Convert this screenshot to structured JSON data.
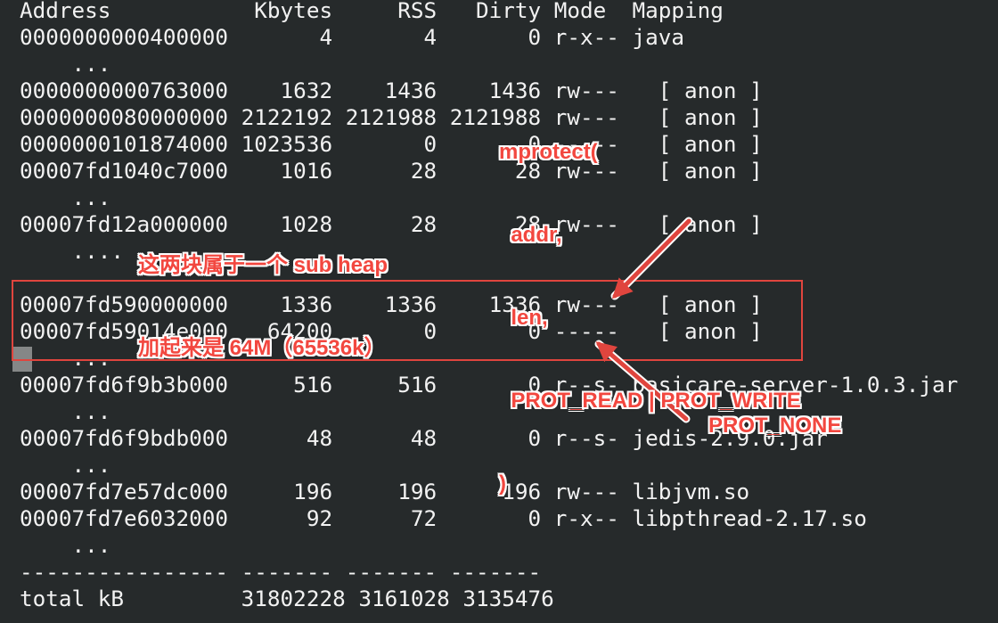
{
  "terminal": {
    "lines": [
      "Address           Kbytes     RSS   Dirty Mode  Mapping",
      "0000000000400000       4       4       0 r-x-- java",
      "    ...",
      "0000000000763000    1632    1436    1436 rw---   [ anon ]",
      "0000000080000000 2122192 2121988 2121988 rw---   [ anon ]",
      "0000000101874000 1023536       0       0 -----   [ anon ]",
      "00007fd1040c7000    1016      28      28 rw---   [ anon ]",
      "    ...",
      "00007fd12a000000    1028      28      28 rw---   [ anon ]",
      "    ....",
      "",
      "00007fd590000000    1336    1336    1336 rw---   [ anon ]",
      "00007fd59014e000   64200       0       0 -----   [ anon ]",
      "    ...",
      "00007fd6f9b3b000     516     516       0 r--s- basicare-server-1.0.3.jar",
      "    ...",
      "00007fd6f9bdb000      48      48       0 r--s- jedis-2.9.0.jar",
      "    ...",
      "00007fd7e57dc000     196     196     196 rw--- libjvm.so",
      "00007fd7e6032000      92      72       0 r-x-- libpthread-2.17.so",
      "    ...",
      "---------------- ------- ------- -------",
      "total kB         31802228 3161028 3135476"
    ]
  },
  "annotations": {
    "mprotect": [
      "mprotect(",
      "  addr,",
      "  len,",
      "  PROT_READ | PROT_WRITE",
      ")"
    ],
    "subheap": [
      "这两块属于一个 sub heap",
      "加起来是 64M（65536k）"
    ],
    "prot_none": "PROT_NONE"
  },
  "colors": {
    "background": "#262a2b",
    "text": "#f2f2f2",
    "annotation": "#f2473f",
    "highlight_box": "#e0453e"
  }
}
